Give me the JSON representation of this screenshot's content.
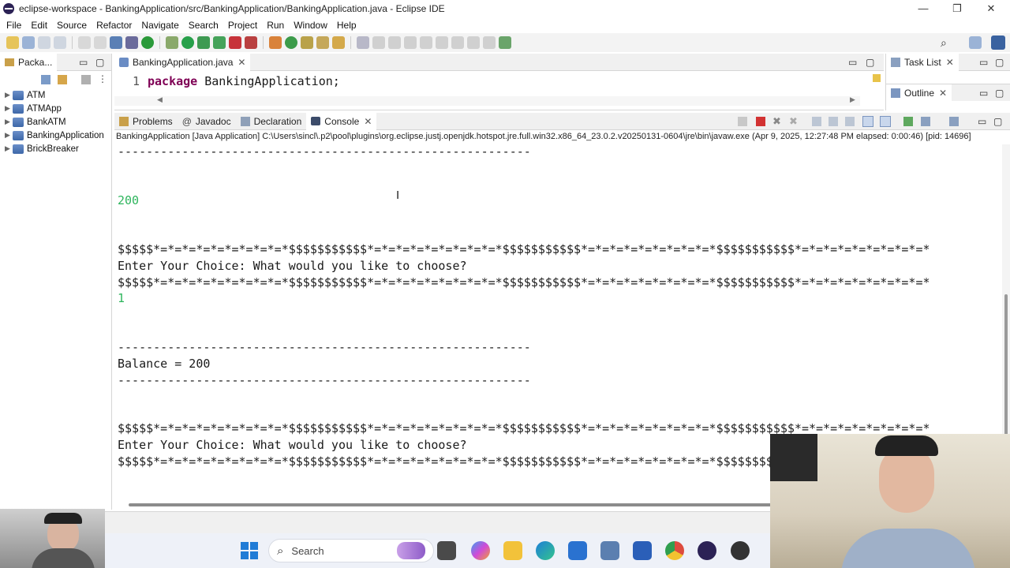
{
  "window": {
    "title": "eclipse-workspace - BankingApplication/src/BankingApplication/BankingApplication.java - Eclipse IDE",
    "minimize": "—",
    "maximize": "❐",
    "close": "✕"
  },
  "menu": [
    "File",
    "Edit",
    "Source",
    "Refactor",
    "Navigate",
    "Search",
    "Project",
    "Run",
    "Window",
    "Help"
  ],
  "package_explorer": {
    "tab_label": "Packa...",
    "projects": [
      "ATM",
      "ATMApp",
      "BankATM",
      "BankingApplication",
      "BrickBreaker"
    ]
  },
  "editor": {
    "tab_label": "BankingApplication.java",
    "line_number": "1",
    "keyword": "package",
    "code_rest": "BankingApplication;"
  },
  "right_views": {
    "task_list": "Task List",
    "outline": "Outline"
  },
  "bottom_tabs": {
    "problems": "Problems",
    "javadoc": "Javadoc",
    "declaration": "Declaration",
    "console": "Console"
  },
  "console": {
    "launch_info": "BankingApplication [Java Application] C:\\Users\\sincl\\.p2\\pool\\plugins\\org.eclipse.justj.openjdk.hotspot.jre.full.win32.x86_64_23.0.2.v20250131-0604\\jre\\bin\\javaw.exe  (Apr 9, 2025, 12:27:48 PM elapsed: 0:00:46) [pid: 14696]",
    "dash_line": "----------------------------------------------------------",
    "input_200": "200",
    "star_line": "$$$$$*=*=*=*=*=*=*=*=*=*$$$$$$$$$$$*=*=*=*=*=*=*=*=*=*$$$$$$$$$$$*=*=*=*=*=*=*=*=*=*$$$$$$$$$$$*=*=*=*=*=*=*=*=*=*",
    "prompt": "Enter Your Choice: What would you like to choose?",
    "input_1": "1",
    "balance": "Balance = 200"
  },
  "taskbar": {
    "search_placeholder": "Search"
  },
  "colors": {
    "console_input": "#2eb55d",
    "keyword": "#7f0055",
    "taskbar_bg": "#eef1f8"
  }
}
